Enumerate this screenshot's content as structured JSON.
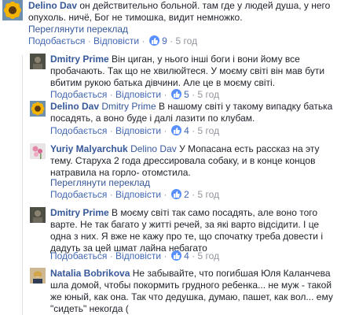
{
  "ui": {
    "see_translation": "Переглянути переклад",
    "like": "Подобається",
    "reply": "Відповісти",
    "dot": "·"
  },
  "colors": {
    "link": "#365899",
    "meta": "#90949c",
    "like_badge": "#5890ff"
  },
  "comments": [
    {
      "author": "Delino Dav",
      "text": "он действительно больной. там где у людей душа, у него опухоль. ничё, Бог не тимошка, видит немножко.",
      "reactions": "9",
      "time": "5 год",
      "avatar": "sunflower"
    },
    {
      "author": "Dmitry Prime",
      "text": "Він циган, у нього інші боги і вони йому все пробачають. Так що не хвилюйтеся. У моєму світі він мав бути вбитим рукою батька дівчини. Але це в моєму світі.",
      "reactions": "5",
      "time": "5 год",
      "avatar": "dark-photo"
    },
    {
      "author": "Delino Dav",
      "mention": "Dmitry Prime",
      "text": "В нашому світі у такому випадку батька посадять, а воно буде і далі лазити по клубам.",
      "reactions": "4",
      "time": "5 год",
      "avatar": "sunflower"
    },
    {
      "author": "Yuriy Malyarchuk",
      "mention": "Delino Dav",
      "text": "У Мопасана есть рассказ на эту тему. Старуха 2 года дрессировала собаку, и в конце концов натравила на горло- отомстила.",
      "reactions": "2",
      "time": "5 год",
      "avatar": "pink-flowers"
    },
    {
      "author": "Dmitry Prime",
      "text": "В моєму світі так само посадять, але воно того варте. Не так багато у житті речей, за які варто відсідити. І це одна з них. Я вже не кажу про те, що спочатку треба довести і дадуть за цей шмат лайна небагато",
      "reactions": "4",
      "time": "5 год",
      "avatar": "dark-photo"
    },
    {
      "author": "Natalia Bobrikova",
      "text": "Не забывайте, что погибшая Юля Каланчева шла домой, чтобы покормить грудного ребенка... не муж - такой же юный, как она. Так что дедушка, думаю, пашет, как вол... ему \"сидеть\" некогда (",
      "avatar": "woman-photo"
    }
  ]
}
